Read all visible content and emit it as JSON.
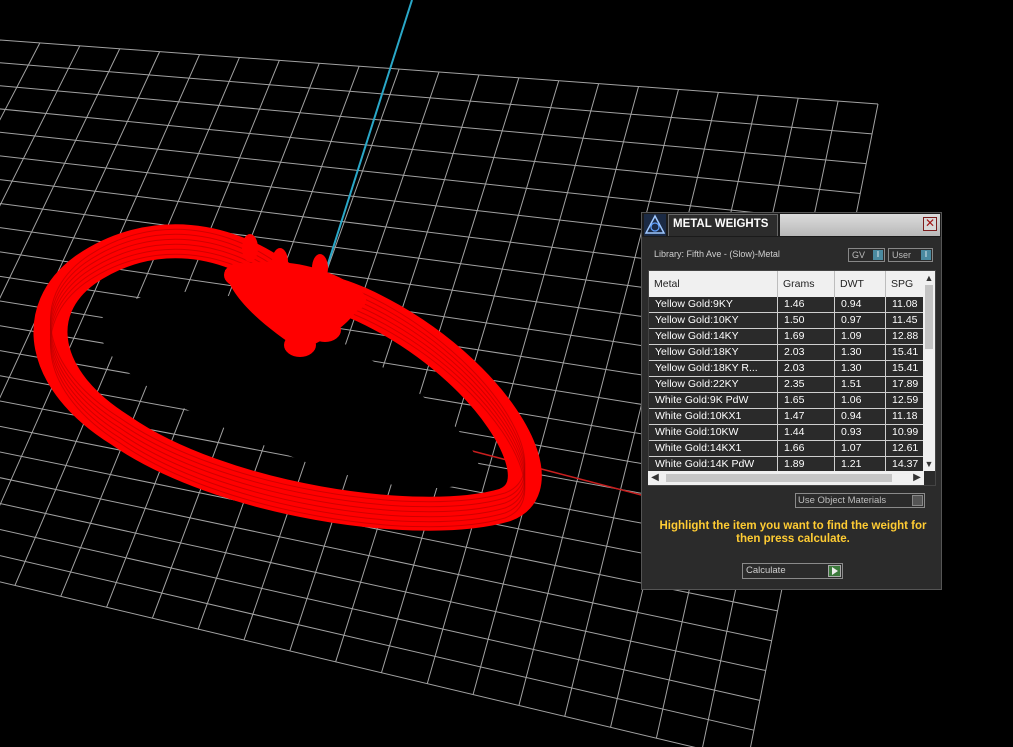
{
  "panel": {
    "title": "METAL WEIGHTS",
    "close_symbol": "✕",
    "library_label": "Library: Fifth Ave - (Slow)-Metal",
    "toggles": {
      "gv": "GV",
      "user": "User",
      "knob": "I"
    },
    "table": {
      "headers": [
        "Metal",
        "Grams",
        "DWT",
        "SPG"
      ],
      "rows": [
        [
          "Yellow Gold:9KY",
          "1.46",
          "0.94",
          "11.08"
        ],
        [
          "Yellow Gold:10KY",
          "1.50",
          "0.97",
          "11.45"
        ],
        [
          "Yellow Gold:14KY",
          "1.69",
          "1.09",
          "12.88"
        ],
        [
          "Yellow Gold:18KY",
          "2.03",
          "1.30",
          "15.41"
        ],
        [
          "Yellow Gold:18KY R...",
          "2.03",
          "1.30",
          "15.41"
        ],
        [
          "Yellow Gold:22KY",
          "2.35",
          "1.51",
          "17.89"
        ],
        [
          "White Gold:9K PdW",
          "1.65",
          "1.06",
          "12.59"
        ],
        [
          "White Gold:10KX1",
          "1.47",
          "0.94",
          "11.18"
        ],
        [
          "White Gold:10KW",
          "1.44",
          "0.93",
          "10.99"
        ],
        [
          "White Gold:14KX1",
          "1.66",
          "1.07",
          "12.61"
        ],
        [
          "White Gold:14K PdW",
          "1.89",
          "1.21",
          "14.37"
        ]
      ]
    },
    "use_object_materials": "Use Object Materials",
    "instruction": "Highlight the item you want to find the weight for then press calculate.",
    "calculate_label": "Calculate"
  },
  "colors": {
    "model": "#ff0000",
    "grid": "#d8d8d8",
    "y_axis": "#2aa8c8",
    "x_axis": "#c81e1e",
    "instruction": "#ffcc33"
  }
}
